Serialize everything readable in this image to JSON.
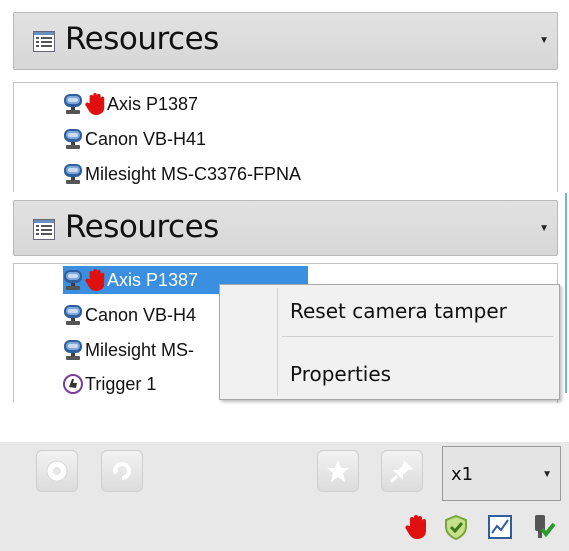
{
  "panel1": {
    "header": {
      "title": "Resources",
      "dropdown_icon": "chevron-down-icon"
    },
    "items": [
      {
        "label": "Axis P1387",
        "icon": "camera-icon",
        "badge": "tamper-hand-icon"
      },
      {
        "label": "Canon VB-H41",
        "icon": "camera-icon"
      },
      {
        "label": "Milesight MS-C3376-FPNA",
        "icon": "camera-icon"
      }
    ]
  },
  "panel2": {
    "header": {
      "title": "Resources",
      "dropdown_icon": "chevron-down-icon"
    },
    "items": [
      {
        "label": "Axis P1387",
        "icon": "camera-icon",
        "badge": "tamper-hand-icon",
        "selected": true
      },
      {
        "label": "Canon VB-H4",
        "icon": "camera-icon"
      },
      {
        "label": "Milesight MS-",
        "icon": "camera-icon"
      },
      {
        "label": "Trigger 1",
        "icon": "trigger-icon"
      }
    ],
    "context_menu": {
      "items": [
        "Reset camera tamper",
        "Properties"
      ]
    }
  },
  "toolbar": {
    "speed": {
      "value": "x1"
    },
    "buttons": [
      "record-icon",
      "loop-icon",
      "bookmark-star-icon",
      "pin-icon"
    ],
    "status_icons": [
      "tamper-hand-icon",
      "shield-check-icon",
      "chart-icon",
      "plug-check-icon"
    ]
  },
  "colors": {
    "selection": "#3b8fe0",
    "hand_red": "#e01010",
    "header_bg": "#dcdcdc",
    "toolbar_bg": "#e8e8e8"
  }
}
